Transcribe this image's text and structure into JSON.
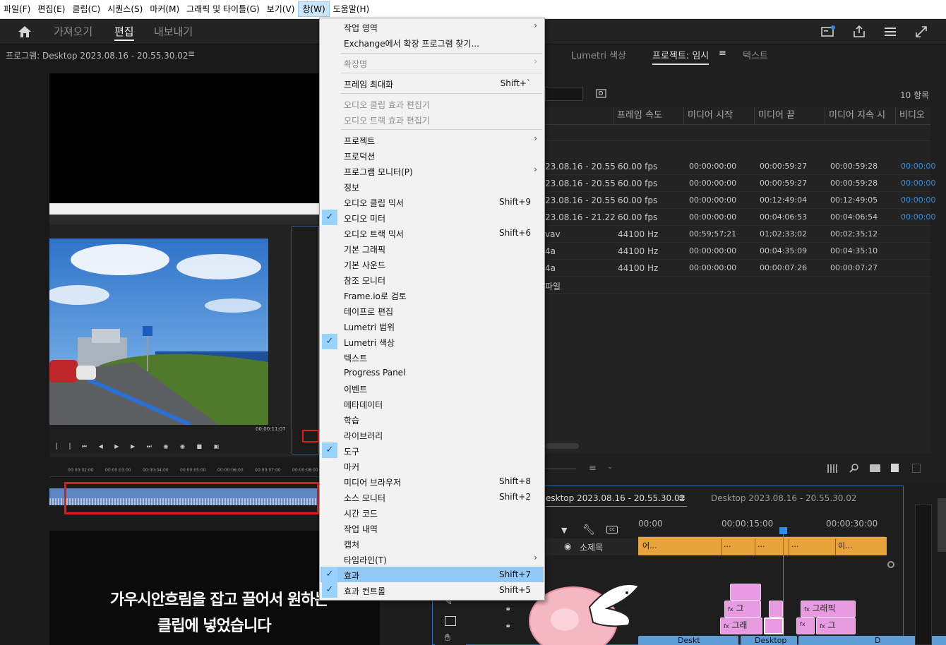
{
  "menubar": {
    "items": [
      "파일(F)",
      "편집(E)",
      "클립(C)",
      "시퀀스(S)",
      "마커(M)",
      "그래픽 및 타이틀(G)",
      "보기(V)",
      "창(W)",
      "도움말(H)"
    ]
  },
  "header": {
    "tabs": [
      "가져오기",
      "편집",
      "내보내기"
    ],
    "active_tab": "편집"
  },
  "program_monitor": {
    "title": "프로그램: Desktop 2023.08.16 - 20.55.30.02",
    "timecodes": [
      "00:00:02:00",
      "00:00:03:00",
      "00:00:04:00",
      "00:00:05:00",
      "00:00:06:00",
      "00:00:07:00",
      "00:00:08:00"
    ],
    "caption_line1": "가우시안흐림을 잡고 끌어서 원하는",
    "caption_line2": "클립에 넣었습니다"
  },
  "right_panel": {
    "tabs": [
      "Lumetri 색상",
      "프로젝트: 임시",
      "텍스트"
    ],
    "active_tab": "프로젝트: 임시",
    "item_count": "10 항목",
    "columns": [
      "프레임 속도",
      "미디어 시작",
      "미디어 끝",
      "미디어 지속 시",
      "비디오"
    ],
    "rows": [
      {
        "name": "23.08.16 - 20.55",
        "fps": "60.00 fps",
        "start": "00:00:00:00",
        "end": "00:00:59:27",
        "dur": "00:00:59:28",
        "video": "00:00:00"
      },
      {
        "name": "23.08.16 - 20.55",
        "fps": "60.00 fps",
        "start": "00:00:00:00",
        "end": "00:00:59:27",
        "dur": "00:00:59:28",
        "video": "00:00:00"
      },
      {
        "name": "23.08.16 - 20.55",
        "fps": "60.00 fps",
        "start": "00:00:00:00",
        "end": "00:12:49:04",
        "dur": "00:12:49:05",
        "video": "00:00:00"
      },
      {
        "name": "23.08.16 - 21.22",
        "fps": "60.00 fps",
        "start": "00:00:00:00",
        "end": "00:04:06:53",
        "dur": "00:04:06:54",
        "video": "00:00:00"
      },
      {
        "name": "vav",
        "fps": "44100 Hz",
        "start": "00;59;57;21",
        "end": "01;02;33;02",
        "dur": "00;02;35;12",
        "video": ""
      },
      {
        "name": "4a",
        "fps": "44100 Hz",
        "start": "00:00:00:00",
        "end": "00:04:35:09",
        "dur": "00:04:35:10",
        "video": ""
      },
      {
        "name": "4a",
        "fps": "44100 Hz",
        "start": "00:00:00:00",
        "end": "00:00:07:26",
        "dur": "00:00:07:27",
        "video": ""
      },
      {
        "name": "파일",
        "fps": "",
        "start": "",
        "end": "",
        "dur": "",
        "video": ""
      }
    ]
  },
  "timeline": {
    "tab_active": "esktop 2023.08.16 - 20.55.30.02",
    "tab_other": "Desktop 2023.08.16 - 20.55.30.02",
    "ruler": [
      "00:00",
      "00:00:15:00",
      "00:00:30:00"
    ],
    "subtitle_track": "소제목",
    "subtitle_clips": [
      "어...",
      "...",
      "...",
      "...",
      "이..."
    ],
    "clip_labels": [
      "그",
      "그래픽",
      "그래",
      "그",
      "Deskt",
      "Desktop",
      "D"
    ]
  },
  "window_menu": {
    "items": [
      {
        "label": "작업 영역",
        "shortcut": "",
        "submenu": true,
        "checked": false,
        "disabled": false
      },
      {
        "label": "Exchange에서 확장 프로그램 찾기...",
        "shortcut": "",
        "submenu": false,
        "checked": false,
        "disabled": false
      },
      {
        "label": "확장명",
        "shortcut": "",
        "submenu": true,
        "checked": false,
        "disabled": true
      },
      {
        "label": "프레임 최대화",
        "shortcut": "Shift+`",
        "submenu": false,
        "checked": false,
        "disabled": false
      },
      {
        "label": "오디오 클립 효과 편집기",
        "shortcut": "",
        "submenu": false,
        "checked": false,
        "disabled": true
      },
      {
        "label": "오디오 트랙 효과 편집기",
        "shortcut": "",
        "submenu": false,
        "checked": false,
        "disabled": true
      },
      {
        "label": "프로젝트",
        "shortcut": "",
        "submenu": true,
        "checked": false,
        "disabled": false
      },
      {
        "label": "프로덕션",
        "shortcut": "",
        "submenu": false,
        "checked": false,
        "disabled": false
      },
      {
        "label": "프로그램 모니터(P)",
        "shortcut": "",
        "submenu": true,
        "checked": false,
        "disabled": false
      },
      {
        "label": "정보",
        "shortcut": "",
        "submenu": false,
        "checked": false,
        "disabled": false
      },
      {
        "label": "오디오 클립 믹서",
        "shortcut": "Shift+9",
        "submenu": false,
        "checked": false,
        "disabled": false
      },
      {
        "label": "오디오 미터",
        "shortcut": "",
        "submenu": false,
        "checked": true,
        "disabled": false
      },
      {
        "label": "오디오 트랙 믹서",
        "shortcut": "Shift+6",
        "submenu": false,
        "checked": false,
        "disabled": false
      },
      {
        "label": "기본 그래픽",
        "shortcut": "",
        "submenu": false,
        "checked": false,
        "disabled": false
      },
      {
        "label": "기본 사운드",
        "shortcut": "",
        "submenu": false,
        "checked": false,
        "disabled": false
      },
      {
        "label": "참조 모니터",
        "shortcut": "",
        "submenu": false,
        "checked": false,
        "disabled": false
      },
      {
        "label": "Frame.io로 검토",
        "shortcut": "",
        "submenu": false,
        "checked": false,
        "disabled": false
      },
      {
        "label": "테이프로 편집",
        "shortcut": "",
        "submenu": false,
        "checked": false,
        "disabled": false
      },
      {
        "label": "Lumetri 범위",
        "shortcut": "",
        "submenu": false,
        "checked": false,
        "disabled": false
      },
      {
        "label": "Lumetri 색상",
        "shortcut": "",
        "submenu": false,
        "checked": true,
        "disabled": false
      },
      {
        "label": "텍스트",
        "shortcut": "",
        "submenu": false,
        "checked": false,
        "disabled": false
      },
      {
        "label": "Progress Panel",
        "shortcut": "",
        "submenu": false,
        "checked": false,
        "disabled": false
      },
      {
        "label": "이벤트",
        "shortcut": "",
        "submenu": false,
        "checked": false,
        "disabled": false
      },
      {
        "label": "메타데이터",
        "shortcut": "",
        "submenu": false,
        "checked": false,
        "disabled": false
      },
      {
        "label": "학습",
        "shortcut": "",
        "submenu": false,
        "checked": false,
        "disabled": false
      },
      {
        "label": "라이브러리",
        "shortcut": "",
        "submenu": false,
        "checked": false,
        "disabled": false
      },
      {
        "label": "도구",
        "shortcut": "",
        "submenu": false,
        "checked": true,
        "disabled": false
      },
      {
        "label": "마커",
        "shortcut": "",
        "submenu": false,
        "checked": false,
        "disabled": false
      },
      {
        "label": "미디어 브라우저",
        "shortcut": "Shift+8",
        "submenu": false,
        "checked": false,
        "disabled": false
      },
      {
        "label": "소스 모니터",
        "shortcut": "Shift+2",
        "submenu": false,
        "checked": false,
        "disabled": false
      },
      {
        "label": "시간 코드",
        "shortcut": "",
        "submenu": false,
        "checked": false,
        "disabled": false
      },
      {
        "label": "작업 내역",
        "shortcut": "",
        "submenu": false,
        "checked": false,
        "disabled": false
      },
      {
        "label": "캡처",
        "shortcut": "",
        "submenu": false,
        "checked": false,
        "disabled": false
      },
      {
        "label": "타임라인(T)",
        "shortcut": "",
        "submenu": true,
        "checked": false,
        "disabled": false
      },
      {
        "label": "효과",
        "shortcut": "Shift+7",
        "submenu": false,
        "checked": true,
        "disabled": false,
        "highlighted": true
      },
      {
        "label": "효과 컨트롤",
        "shortcut": "Shift+5",
        "submenu": false,
        "checked": true,
        "disabled": false
      }
    ]
  },
  "colors": {
    "accent_blue": "#2f8de8",
    "check_bg": "#99d1ff",
    "highlight_bg": "#91c9f7",
    "clip_pink": "#e79be0",
    "clip_orange": "#e9a33b",
    "clip_blue": "#5f9bd5"
  }
}
